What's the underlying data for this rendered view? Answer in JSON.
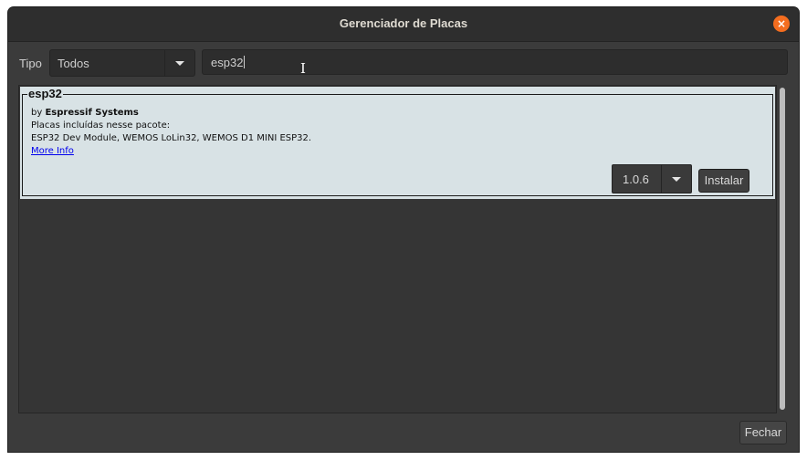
{
  "window": {
    "title": "Gerenciador de Placas",
    "close_icon": "×"
  },
  "filter": {
    "type_label": "Tipo",
    "type_value": "Todos",
    "search_value": "esp32"
  },
  "packages": [
    {
      "name": "esp32",
      "by_prefix": "by",
      "author": "Espressif Systems",
      "boards_label": "Placas incluídas nesse pacote:",
      "boards": "ESP32 Dev Module, WEMOS LoLin32, WEMOS D1 MINI ESP32.",
      "more_info": "More Info",
      "version": "1.0.6",
      "install_label": "Instalar"
    }
  ],
  "footer": {
    "close_label": "Fechar"
  },
  "colors": {
    "background": "#3b3b3b",
    "card": "#d8e2e5",
    "accent_close": "#f46d1f",
    "link": "#0000ee"
  },
  "icons": {
    "dropdown": "chevron-down-icon",
    "close": "close-icon",
    "cursor": "text-cursor-icon"
  }
}
